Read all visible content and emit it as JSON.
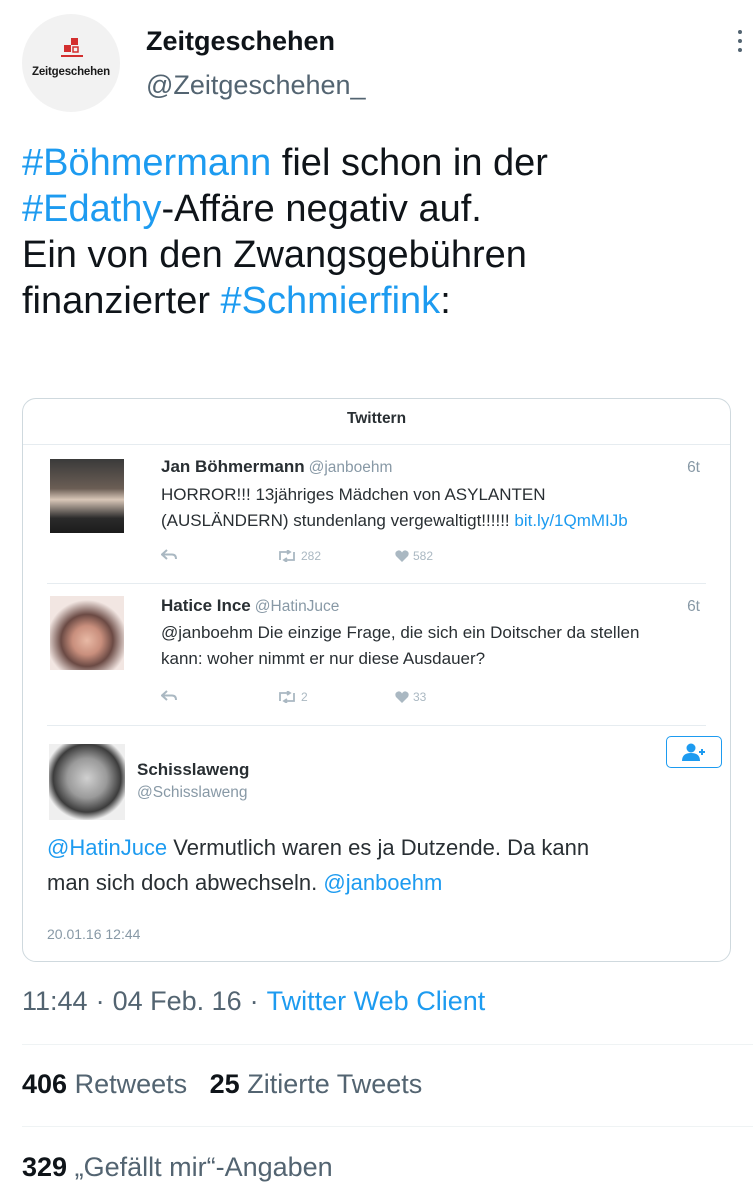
{
  "author": {
    "display_name": "Zeitgeschehen",
    "handle": "@Zeitgeschehen_",
    "avatar_text": "Zeitgeschehen"
  },
  "tweet": {
    "lines": [
      [
        {
          "text": "#Böhmermann",
          "link": true
        },
        {
          "text": " fiel schon in der",
          "link": false
        }
      ],
      [
        {
          "text": "#Edathy",
          "link": true
        },
        {
          "text": "-Affäre negativ auf.",
          "link": false
        }
      ],
      [
        {
          "text": "Ein von den Zwangsgebühren",
          "link": false
        }
      ],
      [
        {
          "text": "finanzierter ",
          "link": false
        },
        {
          "text": "#Schmierfink",
          "link": true
        },
        {
          "text": ":",
          "link": false
        }
      ]
    ]
  },
  "embed": {
    "header": "Twittern",
    "tweets": [
      {
        "name": "Jan Böhmermann",
        "handle": "@janboehm",
        "time": "6t",
        "text_lines": [
          [
            {
              "text": "HORROR!!! 13jähriges Mädchen von ASYLANTEN",
              "link": false
            }
          ],
          [
            {
              "text": "(AUSLÄNDERN) stundenlang vergewaltigt!!!!!! ",
              "link": false
            },
            {
              "text": "bit.ly/1QmMIJb",
              "link": true
            }
          ]
        ],
        "retweets": "282",
        "likes": "582"
      },
      {
        "name": "Hatice Ince",
        "handle": "@HatinJuce",
        "time": "6t",
        "text_lines": [
          [
            {
              "text": "@janboehm Die einzige Frage, die sich ein Doitscher da stellen",
              "link": false
            }
          ],
          [
            {
              "text": "kann: woher nimmt er nur diese Ausdauer?",
              "link": false
            }
          ]
        ],
        "retweets": "2",
        "likes": "33"
      }
    ],
    "quote": {
      "name": "Schisslaweng",
      "handle": "@Schisslaweng",
      "text_lines": [
        [
          {
            "text": "@HatinJuce",
            "link": true
          },
          {
            "text": " Vermutlich waren es ja Dutzende. Da kann",
            "link": false
          }
        ],
        [
          {
            "text": "man sich doch abwechseln. ",
            "link": false
          },
          {
            "text": "@janboehm",
            "link": true
          }
        ]
      ],
      "date": "20.01.16 12:44"
    }
  },
  "meta": {
    "time": "11:44",
    "date": "04 Feb. 16",
    "client": "Twitter Web Client"
  },
  "stats": {
    "retweets_count": "406",
    "retweets_label": "Retweets",
    "quotes_count": "25",
    "quotes_label": "Zitierte Tweets",
    "likes_count": "329",
    "likes_label": "„Gefällt mir“-Angaben"
  },
  "colors": {
    "link": "#1d9bf0",
    "text": "#0f1419",
    "secondary": "#536471"
  }
}
